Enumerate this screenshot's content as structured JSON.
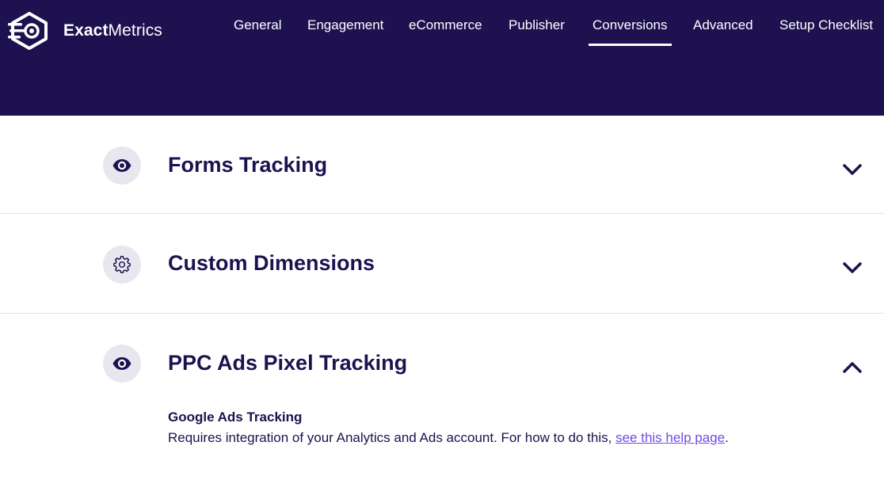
{
  "brand": {
    "name_bold": "Exact",
    "name_regular": "Metrics",
    "icon": "exactmetrics-logo-icon"
  },
  "nav": {
    "items": [
      {
        "label": "General"
      },
      {
        "label": "Engagement"
      },
      {
        "label": "eCommerce"
      },
      {
        "label": "Publisher"
      },
      {
        "label": "Conversions",
        "active": true
      },
      {
        "label": "Advanced"
      },
      {
        "label": "Setup Checklist"
      }
    ]
  },
  "sections": [
    {
      "title": "Forms Tracking",
      "icon": "eye-icon",
      "state": "collapsed"
    },
    {
      "title": "Custom Dimensions",
      "icon": "gear-icon",
      "state": "collapsed"
    },
    {
      "title": "PPC Ads Pixel Tracking",
      "icon": "eye-icon",
      "state": "expanded"
    }
  ],
  "ppc": {
    "subtitle": "Google Ads Tracking",
    "desc_before": "Requires integration of your Analytics and Ads account. For how to do this, ",
    "link_text": "see this help page",
    "desc_after": "."
  },
  "colors": {
    "header_bg": "#1e1150",
    "text": "#1e1150",
    "link": "#6f4be2",
    "icon_bg": "#e8e7ef"
  }
}
